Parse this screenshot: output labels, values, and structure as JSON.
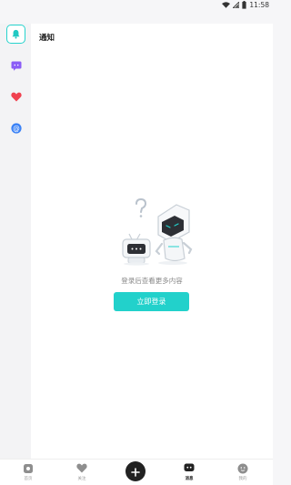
{
  "status_bar": {
    "time": "11:58"
  },
  "side_rail": {
    "items": [
      {
        "name": "bell",
        "color": "#20c9c3",
        "active": true
      },
      {
        "name": "message",
        "color": "#8b5cf6",
        "active": false
      },
      {
        "name": "heart",
        "color": "#f0414f",
        "active": false
      },
      {
        "name": "at",
        "color": "#3b82f6",
        "active": false
      }
    ]
  },
  "panel": {
    "title": "通知",
    "empty_text": "登录后查看更多内容",
    "login_label": "立即登录"
  },
  "tab_bar": {
    "tabs": [
      {
        "label": "首页",
        "icon": "home-icon",
        "active": false
      },
      {
        "label": "关注",
        "icon": "heart-icon",
        "active": false
      },
      {
        "label": "",
        "icon": "plus-icon",
        "active": false
      },
      {
        "label": "消息",
        "icon": "message-icon",
        "active": true
      },
      {
        "label": "我的",
        "icon": "profile-icon",
        "active": false
      }
    ]
  },
  "colors": {
    "accent": "#22d1cb",
    "dark": "#222222"
  }
}
